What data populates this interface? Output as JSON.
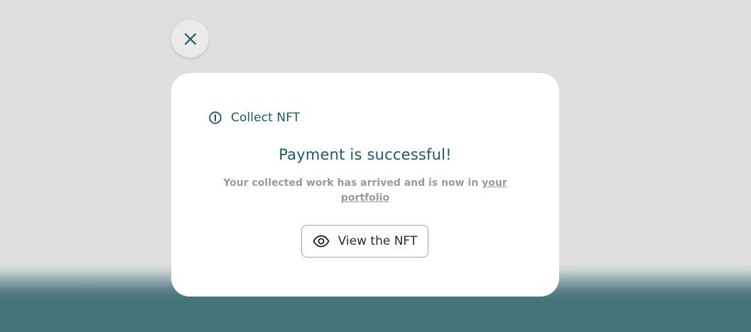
{
  "colors": {
    "accent": "#1f5a60",
    "muted_text": "#9a9a9a",
    "overlay": "#dfdfdf",
    "footer_teal": "#447276"
  },
  "close_button": {
    "icon": "close-icon"
  },
  "modal": {
    "header_icon": "info-circle-icon",
    "header_title": "Collect NFT",
    "headline": "Payment is successful!",
    "message_text": "Your collected work has arrived and is now in ",
    "message_link": "your portfolio",
    "view_button": {
      "icon": "eye-icon",
      "label": "View the NFT"
    }
  }
}
